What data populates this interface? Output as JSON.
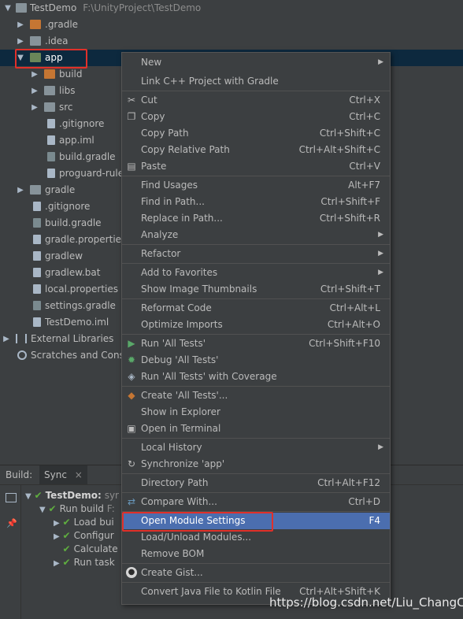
{
  "project_tree": {
    "root": {
      "label": "TestDemo",
      "path": "F:\\UnityProject\\TestDemo"
    },
    "items": [
      {
        "label": ".gradle"
      },
      {
        "label": ".idea"
      },
      {
        "label": "app"
      },
      {
        "label": "build"
      },
      {
        "label": "libs"
      },
      {
        "label": "src"
      },
      {
        "label": ".gitignore"
      },
      {
        "label": "app.iml"
      },
      {
        "label": "build.gradle"
      },
      {
        "label": "proguard-rule"
      },
      {
        "label": "gradle"
      },
      {
        "label": ".gitignore"
      },
      {
        "label": "build.gradle"
      },
      {
        "label": "gradle.propertie"
      },
      {
        "label": "gradlew"
      },
      {
        "label": "gradlew.bat"
      },
      {
        "label": "local.properties"
      },
      {
        "label": "settings.gradle"
      },
      {
        "label": "TestDemo.iml"
      },
      {
        "label": "External Libraries"
      },
      {
        "label": "Scratches and Cons"
      }
    ]
  },
  "build_panel": {
    "tab_build": "Build:",
    "tab_sync": "Sync",
    "close": "×",
    "rows": [
      "TestDemo:",
      "syr",
      "Run build",
      "F:",
      "Load bui",
      "Configur",
      "Calculate",
      "Run task"
    ]
  },
  "context_menu": {
    "items": [
      {
        "label": "New",
        "shortcut": ""
      },
      {
        "label": "Link C++ Project with Gradle",
        "shortcut": ""
      },
      {
        "label": "Cut",
        "shortcut": "Ctrl+X"
      },
      {
        "label": "Copy",
        "shortcut": "Ctrl+C"
      },
      {
        "label": "Copy Path",
        "shortcut": "Ctrl+Shift+C"
      },
      {
        "label": "Copy Relative Path",
        "shortcut": "Ctrl+Alt+Shift+C"
      },
      {
        "label": "Paste",
        "shortcut": "Ctrl+V"
      },
      {
        "label": "Find Usages",
        "shortcut": "Alt+F7"
      },
      {
        "label": "Find in Path...",
        "shortcut": "Ctrl+Shift+F"
      },
      {
        "label": "Replace in Path...",
        "shortcut": "Ctrl+Shift+R"
      },
      {
        "label": "Analyze",
        "shortcut": ""
      },
      {
        "label": "Refactor",
        "shortcut": ""
      },
      {
        "label": "Add to Favorites",
        "shortcut": ""
      },
      {
        "label": "Show Image Thumbnails",
        "shortcut": "Ctrl+Shift+T"
      },
      {
        "label": "Reformat Code",
        "shortcut": "Ctrl+Alt+L"
      },
      {
        "label": "Optimize Imports",
        "shortcut": "Ctrl+Alt+O"
      },
      {
        "label": "Run 'All Tests'",
        "shortcut": "Ctrl+Shift+F10"
      },
      {
        "label": "Debug 'All Tests'",
        "shortcut": ""
      },
      {
        "label": "Run 'All Tests' with Coverage",
        "shortcut": ""
      },
      {
        "label": "Create 'All Tests'...",
        "shortcut": ""
      },
      {
        "label": "Show in Explorer",
        "shortcut": ""
      },
      {
        "label": "Open in Terminal",
        "shortcut": ""
      },
      {
        "label": "Local History",
        "shortcut": ""
      },
      {
        "label": "Synchronize 'app'",
        "shortcut": ""
      },
      {
        "label": "Directory Path",
        "shortcut": "Ctrl+Alt+F12"
      },
      {
        "label": "Compare With...",
        "shortcut": "Ctrl+D"
      },
      {
        "label": "Open Module Settings",
        "shortcut": "F4"
      },
      {
        "label": "Load/Unload Modules...",
        "shortcut": ""
      },
      {
        "label": "Remove BOM",
        "shortcut": ""
      },
      {
        "label": "Create Gist...",
        "shortcut": ""
      },
      {
        "label": "Convert Java File to Kotlin File",
        "shortcut": "Ctrl+Alt+Shift+K"
      }
    ]
  },
  "watermark": "https://blog.csdn.net/Liu_ChangC",
  "colors": {
    "selection": "#0d293e",
    "menu_highlight": "#4b6eaf",
    "annotation_box": "#e0302a"
  }
}
